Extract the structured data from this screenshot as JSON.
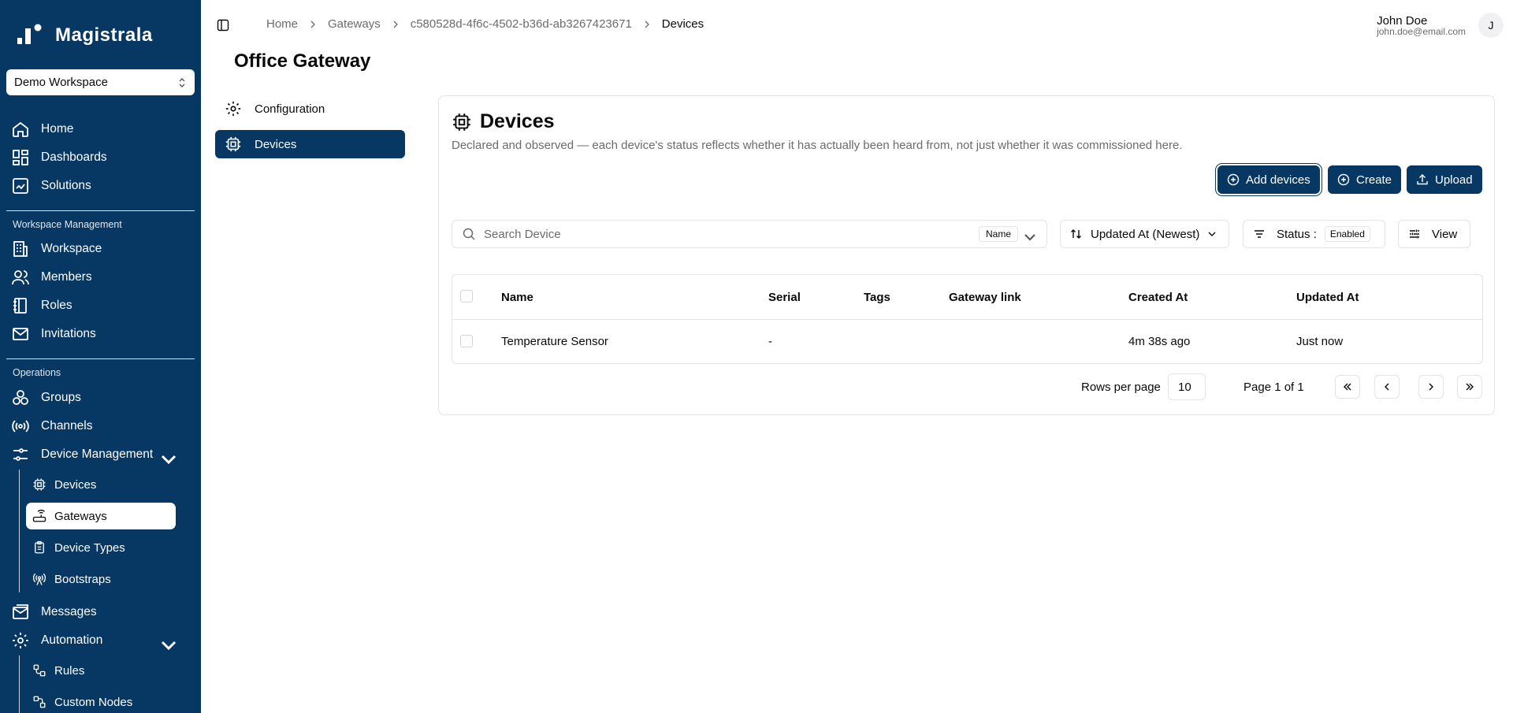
{
  "brand": {
    "name": "Magistrala"
  },
  "workspace": {
    "name": "Demo Workspace"
  },
  "sidebar": {
    "main": [
      {
        "label": "Home",
        "icon": "home-icon"
      },
      {
        "label": "Dashboards",
        "icon": "dashboard-icon"
      },
      {
        "label": "Solutions",
        "icon": "solutions-icon"
      }
    ],
    "workspace_section": "Workspace Management",
    "workspace_items": [
      {
        "label": "Workspace",
        "icon": "building-icon"
      },
      {
        "label": "Members",
        "icon": "users-icon"
      },
      {
        "label": "Roles",
        "icon": "notebook-icon"
      },
      {
        "label": "Invitations",
        "icon": "mail-icon"
      }
    ],
    "operations_section": "Operations",
    "operations_items": [
      {
        "label": "Groups",
        "icon": "groups-icon"
      },
      {
        "label": "Channels",
        "icon": "radio-icon"
      },
      {
        "label": "Device Management",
        "icon": "device-management-icon"
      }
    ],
    "device_sub": [
      {
        "label": "Devices",
        "icon": "cpu-icon"
      },
      {
        "label": "Gateways",
        "icon": "router-icon"
      },
      {
        "label": "Device Types",
        "icon": "clipboard-icon"
      },
      {
        "label": "Bootstraps",
        "icon": "antenna-icon"
      }
    ],
    "more_items": [
      {
        "label": "Messages",
        "icon": "messages-icon"
      },
      {
        "label": "Automation",
        "icon": "gear-icon"
      }
    ],
    "automation_sub": [
      {
        "label": "Rules",
        "icon": "workflow-icon"
      },
      {
        "label": "Custom Nodes",
        "icon": "nodes-icon"
      }
    ]
  },
  "breadcrumb": [
    "Home",
    "Gateways",
    "c580528d-4f6c-4502-b36d-ab3267423671",
    "Devices"
  ],
  "user": {
    "name": "John Doe",
    "email": "john.doe@email.com",
    "initial": "J"
  },
  "page": {
    "title": "Office Gateway"
  },
  "subnav": [
    {
      "label": "Configuration"
    },
    {
      "label": "Devices"
    }
  ],
  "card": {
    "title": "Devices",
    "description": "Declared and observed — each device's status reflects whether it has actually been heard from, not just whether it was commissioned here.",
    "buttons": {
      "add": "Add devices",
      "create": "Create",
      "upload": "Upload"
    }
  },
  "search": {
    "placeholder": "Search Device",
    "field": "Name"
  },
  "sort": {
    "label": "Updated At (Newest)"
  },
  "filter": {
    "label": "Status :",
    "value": "Enabled"
  },
  "view": {
    "label": "View"
  },
  "table": {
    "columns": [
      "Name",
      "Serial",
      "Tags",
      "Gateway link",
      "Created At",
      "Updated At"
    ],
    "rows": [
      {
        "name": "Temperature Sensor",
        "serial": "-",
        "tags": "",
        "gateway_link": "",
        "created": "4m 38s ago",
        "updated": "Just now"
      }
    ]
  },
  "pagination": {
    "rows_label": "Rows per page",
    "rows_value": "10",
    "page_label": "Page 1 of 1"
  }
}
